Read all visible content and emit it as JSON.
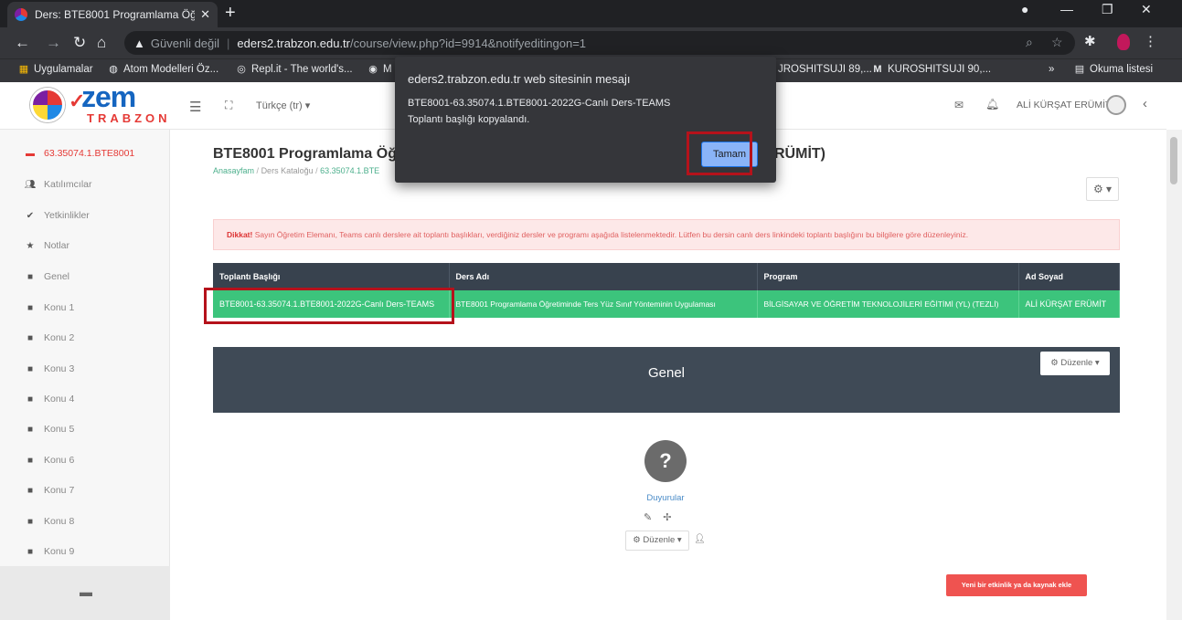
{
  "browser": {
    "tab_title": "Ders: BTE8001 Programlama Öğr",
    "tab_close": "✕",
    "new_tab": "+",
    "url_warning": "Güvenli değil",
    "url_host": "eders2.trabzon.edu.tr",
    "url_path": "/course/view.php?id=9914&notifyeditingon=1",
    "bookmarks": [
      "Uygulamalar",
      "Atom Modelleri Öz...",
      "Repl.it - The world's...",
      "M",
      "JROSHITSUJI 89,...",
      "KUROSHITSUJI 90,...",
      "»",
      "Okuma listesi"
    ]
  },
  "header": {
    "logo_text": "zem",
    "logo_sub": "TRABZON",
    "language": "Türkçe (tr) ▾",
    "user_name": "ALİ KÜRŞAT ERÜMİT"
  },
  "sidebar": {
    "items": [
      {
        "label": "63.35074.1.BTE8001",
        "icon": "course-icon"
      },
      {
        "label": "Katılımcılar",
        "icon": "participants-icon"
      },
      {
        "label": "Yetkinlikler",
        "icon": "competency-icon"
      },
      {
        "label": "Notlar",
        "icon": "star-icon"
      },
      {
        "label": "Genel",
        "icon": "folder-icon"
      },
      {
        "label": "Konu 1",
        "icon": "folder-icon"
      },
      {
        "label": "Konu 2",
        "icon": "folder-icon"
      },
      {
        "label": "Konu 3",
        "icon": "folder-icon"
      },
      {
        "label": "Konu 4",
        "icon": "folder-icon"
      },
      {
        "label": "Konu 5",
        "icon": "folder-icon"
      },
      {
        "label": "Konu 6",
        "icon": "folder-icon"
      },
      {
        "label": "Konu 7",
        "icon": "folder-icon"
      },
      {
        "label": "Konu 8",
        "icon": "folder-icon"
      },
      {
        "label": "Konu 9",
        "icon": "folder-icon"
      }
    ]
  },
  "main": {
    "course_title_left": "BTE8001 Programlama Öğret",
    "course_title_right": "RÜMİT)",
    "breadcrumbs": [
      "Anasayfam",
      "Ders Kataloğu",
      "63.35074.1.BTE"
    ],
    "alert_bold": "Dikkat!",
    "alert_text": " Sayın Öğretim Elemanı, Teams canlı derslere ait toplantı başlıkları, verdiğiniz dersler ve programı aşağıda listelenmektedir. Lütfen bu dersin canlı ders linkindeki toplantı başlığını bu bilgilere göre düzenleyiniz.",
    "table": {
      "headers": [
        "Toplantı Başlığı",
        "Ders Adı",
        "Program",
        "Ad Soyad"
      ],
      "row": [
        "BTE8001-63.35074.1.BTE8001-2022G-Canlı Ders-TEAMS",
        "BTE8001 Programlama Öğretiminde Ters Yüz Sınıf Yönteminin Uygulaması",
        "BİLGİSAYAR VE ÖĞRETİM TEKNOLOJİLERİ EĞİTİMİ (YL) (TEZLİ)",
        "ALİ KÜRŞAT ERÜMİT"
      ]
    },
    "section_title": "Genel",
    "section_edit": "⚙ Düzenle ▾",
    "forum_label": "Duyurular",
    "forum_edit": "⚙ Düzenle ▾",
    "add_activity": "Yeni bir etkinlik ya da kaynak ekle"
  },
  "dialog": {
    "title": "eders2.trabzon.edu.tr web sitesinin mesajı",
    "line1": "BTE8001-63.35074.1.BTE8001-2022G-Canlı Ders-TEAMS",
    "line2": "Toplantı başlığı kopyalandı.",
    "ok": "Tamam"
  },
  "colors": {
    "accent_red": "#e53935",
    "table_header": "#38424e",
    "table_row_green": "#3cc47c",
    "section_bar": "#3f4a56",
    "highlight": "#b5121b",
    "dialog_bg": "#35363a",
    "ok_button": "#8ab4f8"
  }
}
